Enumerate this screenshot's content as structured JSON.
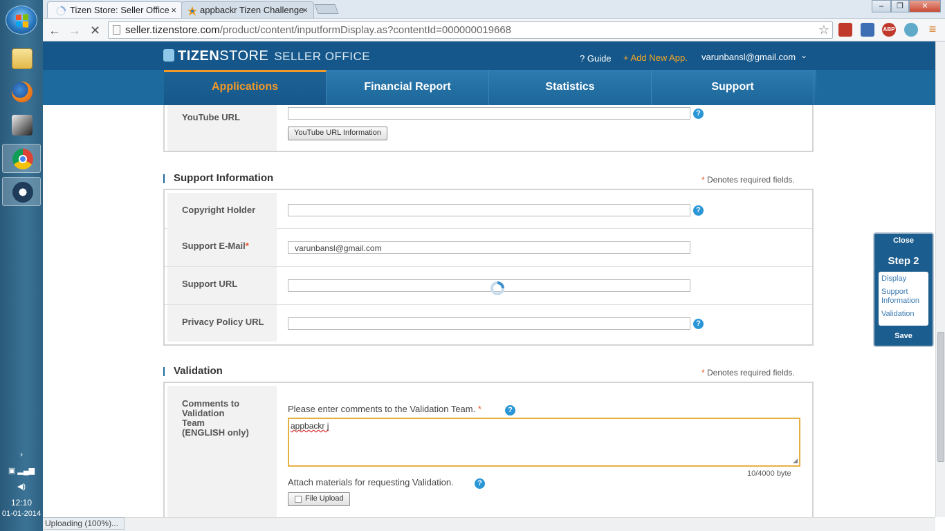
{
  "os": {
    "clock_time": "12:10",
    "clock_date": "01-01-2014"
  },
  "browser": {
    "tabs": [
      {
        "label": "Tizen Store: Seller Office",
        "close": "×"
      },
      {
        "label": "appbackr Tizen Challenge",
        "close": "×"
      }
    ],
    "window_controls": {
      "minimize": "–",
      "maximize": "❐",
      "close": "✕"
    },
    "url_host": "seller.tizenstore.com",
    "url_path": "/product/content/inputformDisplay.as?contentId=000000019668",
    "status_text": "Uploading (100%)..."
  },
  "header": {
    "logo_bold": "TIZEN",
    "logo_thin": "STORE",
    "logo_sub": "SELLER OFFICE",
    "guide": "? Guide",
    "add_app": "+ Add New App.",
    "user_email": "varunbansl@gmail.com"
  },
  "nav": {
    "items": [
      "Applications",
      "Financial Report",
      "Statistics",
      "Support"
    ]
  },
  "display_section": {
    "youtube_label": "YouTube URL",
    "youtube_value": "",
    "youtube_button": "YouTube URL Information"
  },
  "support_section": {
    "title": "Support Information",
    "required_star": "*",
    "required_note": "Denotes required fields.",
    "rows": [
      {
        "label": "Copyright Holder",
        "value": ""
      },
      {
        "label": "Support E-Mail",
        "required": "*",
        "value": "varunbansl@gmail.com"
      },
      {
        "label": "Support URL",
        "value": ""
      },
      {
        "label": "Privacy Policy URL",
        "value": ""
      }
    ]
  },
  "validation_section": {
    "title": "Validation",
    "required_star": "*",
    "required_note": "Denotes required fields.",
    "comments_label_lines": [
      "Comments to",
      "Validation",
      "Team",
      "(ENGLISH only)"
    ],
    "comments_prompt": "Please enter comments to the Validation Team.",
    "comments_star": "*",
    "comments_value": "appbackr j",
    "byte_count": "10/4000 byte",
    "attach_label": "Attach materials for requesting Validation.",
    "file_upload": "File Upload"
  },
  "step_panel": {
    "close": "Close",
    "title": "Step 2",
    "links": [
      "Display",
      "Support Information",
      "Validation"
    ],
    "save": "Save"
  },
  "help_glyph": "?",
  "colors": {
    "header_blue": "#15578a",
    "nav_blue": "#1d6a9f",
    "active_orange": "#f39a26",
    "required_red": "#e5542a",
    "help_blue": "#2a96d6"
  }
}
